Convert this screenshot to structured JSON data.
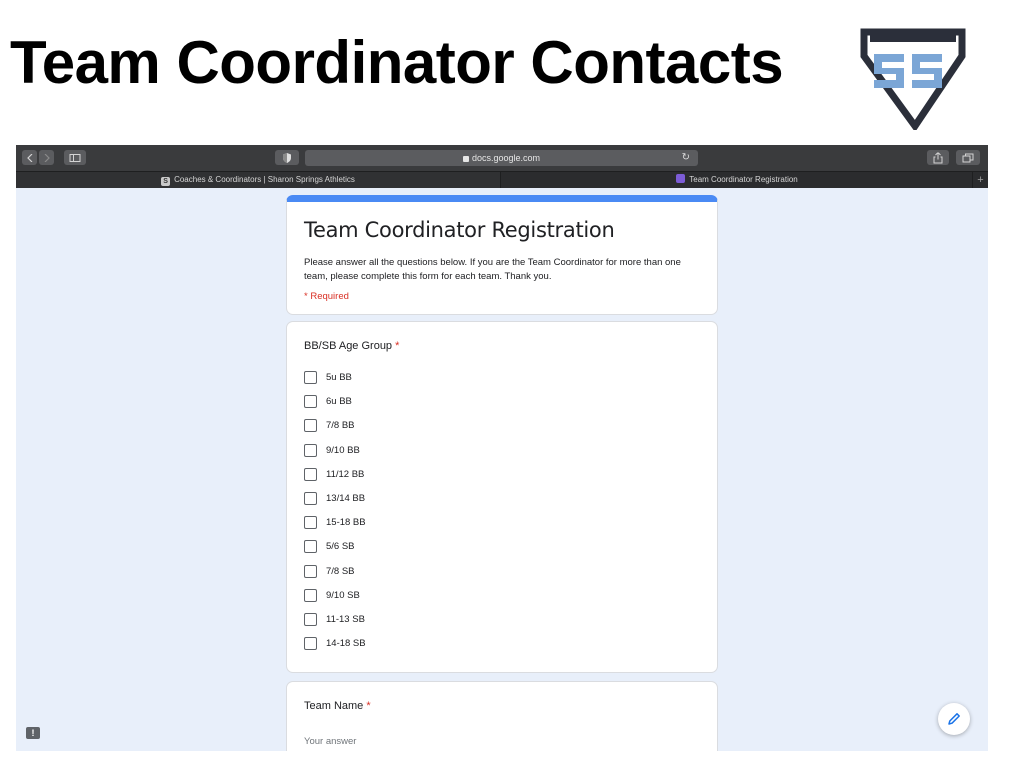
{
  "slide": {
    "title": "Team Coordinator Contacts"
  },
  "logo": {
    "text": "SS",
    "colors": {
      "shield": "#2b2f3a",
      "letters": "#7ba6d6"
    }
  },
  "browser": {
    "address_bar": {
      "url": "docs.google.com",
      "lock_icon": "lock-icon",
      "reload_icon": "reload-icon"
    },
    "toolbar_icons": [
      "back-icon",
      "forward-icon",
      "sidebar-icon",
      "privacy-shield-icon",
      "share-icon",
      "tabs-icon"
    ],
    "tabs": [
      {
        "label": "Coaches & Coordinators | Sharon Springs Athletics",
        "favicon": "S"
      },
      {
        "label": "Team Coordinator Registration",
        "favicon": "forms-icon"
      }
    ],
    "new_tab": "+"
  },
  "form": {
    "accent": "#4a8af4",
    "title": "Team Coordinator Registration",
    "description": "Please answer all the questions below. If you are the Team Coordinator for more than one team, please complete this form for each team. Thank you.",
    "required_note": "* Required",
    "questions": [
      {
        "title": "BB/SB Age Group",
        "required_mark": "*",
        "options": [
          "5u BB",
          "6u BB",
          "7/8 BB",
          "9/10 BB",
          "11/12 BB",
          "13/14 BB",
          "15-18 BB",
          "5/6 SB",
          "7/8 SB",
          "9/10 SB",
          "11-13 SB",
          "14-18 SB"
        ]
      },
      {
        "title": "Team Name",
        "required_mark": "*",
        "placeholder": "Your answer"
      }
    ]
  },
  "fab": {
    "icon": "pencil-icon"
  },
  "feedback": {
    "icon": "feedback-icon",
    "symbol": "!"
  }
}
